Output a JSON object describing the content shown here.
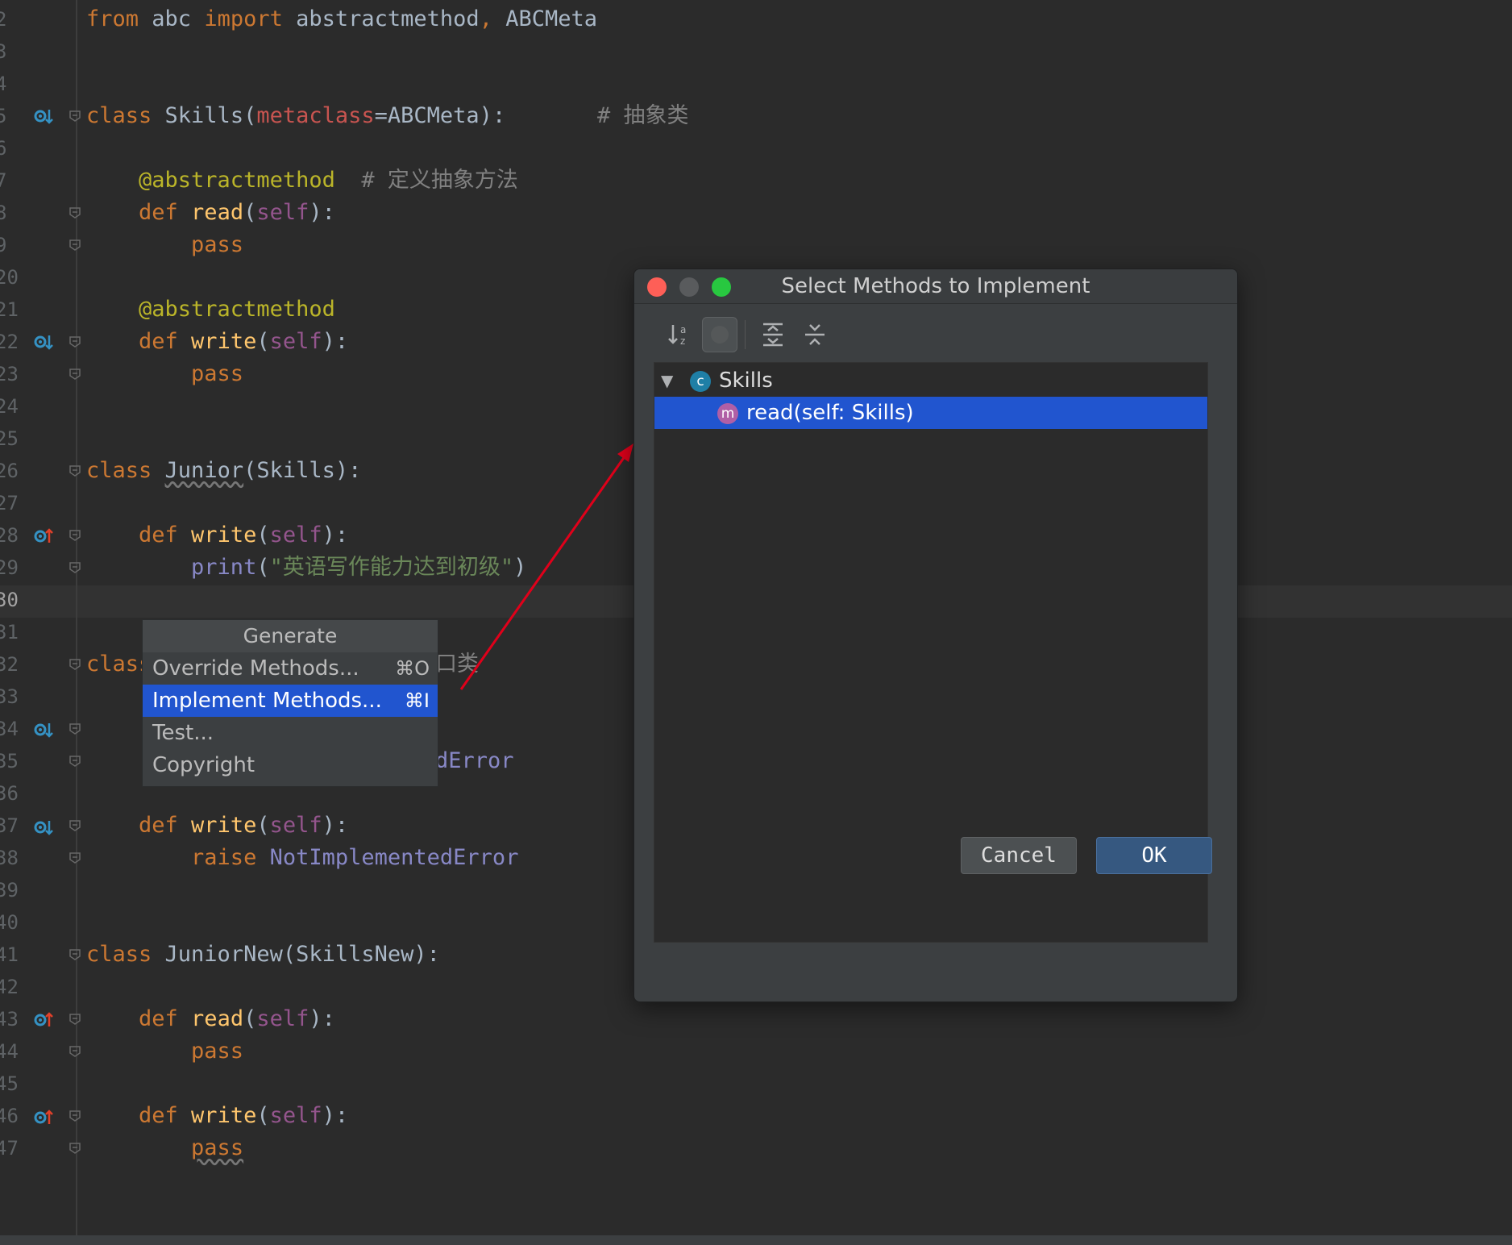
{
  "gutter": {
    "line_numbers": [
      "2",
      "3",
      "4",
      "5",
      "6",
      "7",
      "8",
      "9",
      "20",
      "21",
      "22",
      "23",
      "24",
      "25",
      "26",
      "27",
      "28",
      "29",
      "30",
      "31",
      "32",
      "33",
      "34",
      "35",
      "36",
      "37",
      "38",
      "39",
      "40",
      "41",
      "42",
      "43",
      "44",
      "45",
      "46",
      "47"
    ]
  },
  "code": {
    "l12": {
      "from": "from",
      "mod": " abc ",
      "import": "import",
      "names": " abstractmethod",
      "comma": ",",
      "abc": " ABCMeta"
    },
    "l15": {
      "kw": "class",
      "name": " Skills(",
      "meta": "metaclass",
      "rest": "=ABCMeta):",
      "cmt": "       # 抽象类"
    },
    "l17": {
      "dec": "    @abstractmethod",
      "cmt": "  # 定义抽象方法"
    },
    "l18": {
      "kw": "    def",
      "fn": " read",
      "open": "(",
      "self": "self",
      "close": "):"
    },
    "l19": {
      "kw": "        pass"
    },
    "l21": {
      "dec": "    @abstractmethod"
    },
    "l22": {
      "kw": "    def",
      "fn": " write",
      "open": "(",
      "self": "self",
      "close": "):"
    },
    "l23": {
      "kw": "        pass"
    },
    "l26": {
      "kw": "class",
      "sp": " ",
      "name": "Junior",
      "rest": "(Skills):"
    },
    "l28": {
      "kw": "    def",
      "fn": " write",
      "open": "(",
      "self": "self",
      "close": "):"
    },
    "l29": {
      "bi": "        print",
      "open": "(",
      "str": "\"英语写作能力达到初级\"",
      "close": ")"
    },
    "l32": {
      "kw": "class",
      "tail": "口类"
    },
    "l35": {
      "tail": "dError"
    },
    "l37": {
      "kw": "    def",
      "fn": " write",
      "open": "(",
      "self": "self",
      "close": "):"
    },
    "l38": {
      "kw": "        raise",
      "sp": " ",
      "bi": "NotImplementedError"
    },
    "l41": {
      "kw": "class",
      "name": " JuniorNew(SkillsNew):"
    },
    "l43": {
      "kw": "    def",
      "fn": " read",
      "open": "(",
      "self": "self",
      "close": "):"
    },
    "l44": {
      "kw": "        pass"
    },
    "l46": {
      "kw": "    def",
      "fn": " write",
      "open": "(",
      "self": "self",
      "close": "):"
    },
    "l47": {
      "indent": "        ",
      "kw": "pass"
    }
  },
  "generate_popup": {
    "title": "Generate",
    "items": [
      {
        "label": "Override Methods...",
        "shortcut": "⌘O"
      },
      {
        "label": "Implement Methods...",
        "shortcut": "⌘I"
      },
      {
        "label": "Test..."
      },
      {
        "label": "Copyright"
      }
    ]
  },
  "dialog": {
    "title": "Select Methods to Implement",
    "tree": {
      "class_badge": "c",
      "class_name": "Skills",
      "method_badge": "m",
      "method": "read(self: Skills)"
    },
    "cancel_label": "Cancel",
    "ok_label": "OK"
  },
  "colors": {
    "editor_bg": "#2b2b2b",
    "selection": "#2155cf",
    "keyword": "#cc7832",
    "decorator": "#bbb529",
    "string": "#6a8759",
    "self": "#94558d",
    "arrow": "#e0001a"
  }
}
